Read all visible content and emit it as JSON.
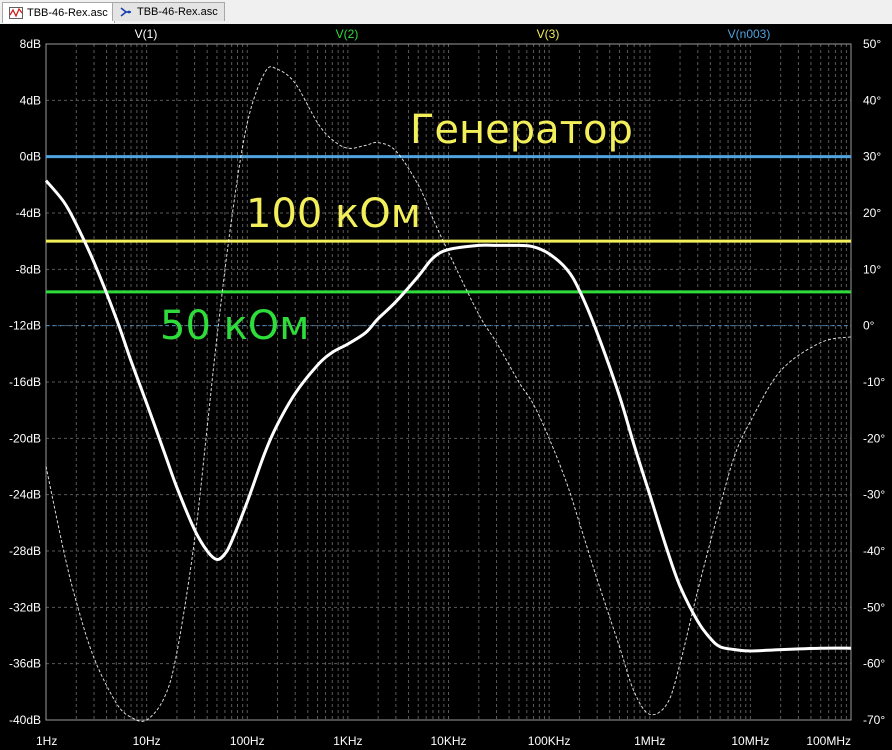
{
  "tabs": [
    {
      "label": "TBB-46-Rex.asc",
      "icon": "waveform-icon",
      "active": true
    },
    {
      "label": "TBB-46-Rex.asc",
      "icon": "schematic-icon",
      "active": false
    }
  ],
  "colors": {
    "background": "#000000",
    "grid": "#5a5a5a",
    "axis_text": "#ffffff",
    "trace_main": "#ffffff",
    "trace_phase": "#ffffff",
    "generator": "#4fa3e0",
    "r100k": "#f2ef5a",
    "r50k": "#2edc3a"
  },
  "annotations": {
    "generator": "Генератор",
    "r100k": "100 кОм",
    "r50k": "50 кОм"
  },
  "chart_data": {
    "type": "line",
    "x_scale": "log",
    "xlim": [
      1,
      100000000
    ],
    "x_ticks": [
      {
        "value": 1,
        "label": "1Hz"
      },
      {
        "value": 10,
        "label": "10Hz"
      },
      {
        "value": 100,
        "label": "100Hz"
      },
      {
        "value": 1000,
        "label": "1KHz"
      },
      {
        "value": 10000,
        "label": "10KHz"
      },
      {
        "value": 100000,
        "label": "100KHz"
      },
      {
        "value": 1000000,
        "label": "1MHz"
      },
      {
        "value": 10000000,
        "label": "10MHz"
      },
      {
        "value": 100000000,
        "label": "100MHz"
      }
    ],
    "y_left": {
      "unit": "dB",
      "ylim": [
        -40,
        8
      ],
      "ticks": [
        {
          "value": 8,
          "label": "8dB"
        },
        {
          "value": 4,
          "label": "4dB"
        },
        {
          "value": 0,
          "label": "0dB"
        },
        {
          "value": -4,
          "label": "-4dB"
        },
        {
          "value": -8,
          "label": "-8dB"
        },
        {
          "value": -12,
          "label": "-12dB"
        },
        {
          "value": -16,
          "label": "-16dB"
        },
        {
          "value": -20,
          "label": "-20dB"
        },
        {
          "value": -24,
          "label": "-24dB"
        },
        {
          "value": -28,
          "label": "-28dB"
        },
        {
          "value": -32,
          "label": "-32dB"
        },
        {
          "value": -36,
          "label": "-36dB"
        },
        {
          "value": -40,
          "label": "-40dB"
        }
      ]
    },
    "y_right": {
      "unit": "°",
      "ylim": [
        -70,
        50
      ],
      "ticks": [
        {
          "value": 50,
          "label": "50°"
        },
        {
          "value": 40,
          "label": "40°"
        },
        {
          "value": 30,
          "label": "30°"
        },
        {
          "value": 20,
          "label": "20°"
        },
        {
          "value": 10,
          "label": "10°"
        },
        {
          "value": 0,
          "label": "0°"
        },
        {
          "value": -10,
          "label": "-10°"
        },
        {
          "value": -20,
          "label": "-20°"
        },
        {
          "value": -30,
          "label": "-30°"
        },
        {
          "value": -40,
          "label": "-40°"
        },
        {
          "value": -50,
          "label": "-50°"
        },
        {
          "value": -60,
          "label": "-60°"
        },
        {
          "value": -70,
          "label": "-70°"
        }
      ]
    },
    "legend": [
      {
        "label": "V(1)",
        "color": "#ffffff"
      },
      {
        "label": "V(2)",
        "color": "#2edc3a"
      },
      {
        "label": "V(3)",
        "color": "#f2ef5a"
      },
      {
        "label": "V(n003)",
        "color": "#4fa3e0"
      }
    ],
    "series": [
      {
        "key": "v1_magnitude",
        "axis": "left",
        "style": "solid",
        "color": "#ffffff",
        "points": [
          [
            1,
            -1.7
          ],
          [
            1.5,
            -3.2
          ],
          [
            2,
            -4.8
          ],
          [
            3,
            -7.5
          ],
          [
            5,
            -11.5
          ],
          [
            7,
            -14.5
          ],
          [
            10,
            -17.5
          ],
          [
            15,
            -21
          ],
          [
            20,
            -23.5
          ],
          [
            30,
            -26.5
          ],
          [
            40,
            -28
          ],
          [
            50,
            -28.6
          ],
          [
            60,
            -28.2
          ],
          [
            70,
            -27.3
          ],
          [
            100,
            -24.5
          ],
          [
            150,
            -21
          ],
          [
            200,
            -19
          ],
          [
            300,
            -16.8
          ],
          [
            500,
            -14.8
          ],
          [
            700,
            -13.9
          ],
          [
            1000,
            -13.3
          ],
          [
            1500,
            -12.5
          ],
          [
            2000,
            -11.5
          ],
          [
            3000,
            -10.3
          ],
          [
            5000,
            -8.5
          ],
          [
            7000,
            -7.2
          ],
          [
            10000,
            -6.6
          ],
          [
            20000,
            -6.3
          ],
          [
            30000,
            -6.3
          ],
          [
            50000,
            -6.3
          ],
          [
            70000,
            -6.4
          ],
          [
            100000,
            -6.9
          ],
          [
            150000,
            -8
          ],
          [
            200000,
            -9.5
          ],
          [
            300000,
            -12.5
          ],
          [
            500000,
            -17
          ],
          [
            700000,
            -20.5
          ],
          [
            1000000,
            -24
          ],
          [
            1500000,
            -28
          ],
          [
            2000000,
            -30.5
          ],
          [
            3000000,
            -33
          ],
          [
            4000000,
            -34.2
          ],
          [
            5000000,
            -34.8
          ],
          [
            7000000,
            -35.0
          ],
          [
            10000000,
            -35.1
          ],
          [
            20000000,
            -35.0
          ],
          [
            50000000,
            -34.9
          ],
          [
            100000000,
            -34.9
          ]
        ]
      },
      {
        "key": "v1_phase",
        "axis": "right",
        "style": "dashed",
        "color": "#ffffff",
        "points": [
          [
            1,
            -25
          ],
          [
            1.5,
            -40
          ],
          [
            2,
            -49
          ],
          [
            3,
            -59
          ],
          [
            5,
            -67
          ],
          [
            7,
            -69.5
          ],
          [
            10,
            -70
          ],
          [
            15,
            -66
          ],
          [
            20,
            -58
          ],
          [
            30,
            -38
          ],
          [
            40,
            -18
          ],
          [
            50,
            -2
          ],
          [
            70,
            19
          ],
          [
            100,
            36
          ],
          [
            150,
            45
          ],
          [
            200,
            45.5
          ],
          [
            300,
            43
          ],
          [
            500,
            36
          ],
          [
            700,
            33
          ],
          [
            1000,
            31.5
          ],
          [
            1500,
            32
          ],
          [
            2000,
            32.5
          ],
          [
            3000,
            31
          ],
          [
            5000,
            25
          ],
          [
            7000,
            19
          ],
          [
            10000,
            13
          ],
          [
            20000,
            2
          ],
          [
            30000,
            -3
          ],
          [
            50000,
            -10
          ],
          [
            70000,
            -14
          ],
          [
            100000,
            -20
          ],
          [
            150000,
            -28
          ],
          [
            200000,
            -35
          ],
          [
            300000,
            -45
          ],
          [
            500000,
            -57
          ],
          [
            700000,
            -65
          ],
          [
            1000000,
            -69
          ],
          [
            1500000,
            -67
          ],
          [
            2000000,
            -60
          ],
          [
            3000000,
            -47
          ],
          [
            5000000,
            -32
          ],
          [
            7000000,
            -23
          ],
          [
            10000000,
            -17
          ],
          [
            20000000,
            -8
          ],
          [
            50000000,
            -3
          ],
          [
            100000000,
            -2
          ]
        ]
      }
    ],
    "hlines": [
      {
        "key": "generator",
        "axis": "left",
        "value": 0,
        "color": "#4fa3e0"
      },
      {
        "key": "r100k",
        "axis": "left",
        "value": -6.0,
        "color": "#f2ef5a"
      },
      {
        "key": "r50k",
        "axis": "left",
        "value": -9.6,
        "color": "#2edc3a"
      }
    ],
    "grid": true
  }
}
